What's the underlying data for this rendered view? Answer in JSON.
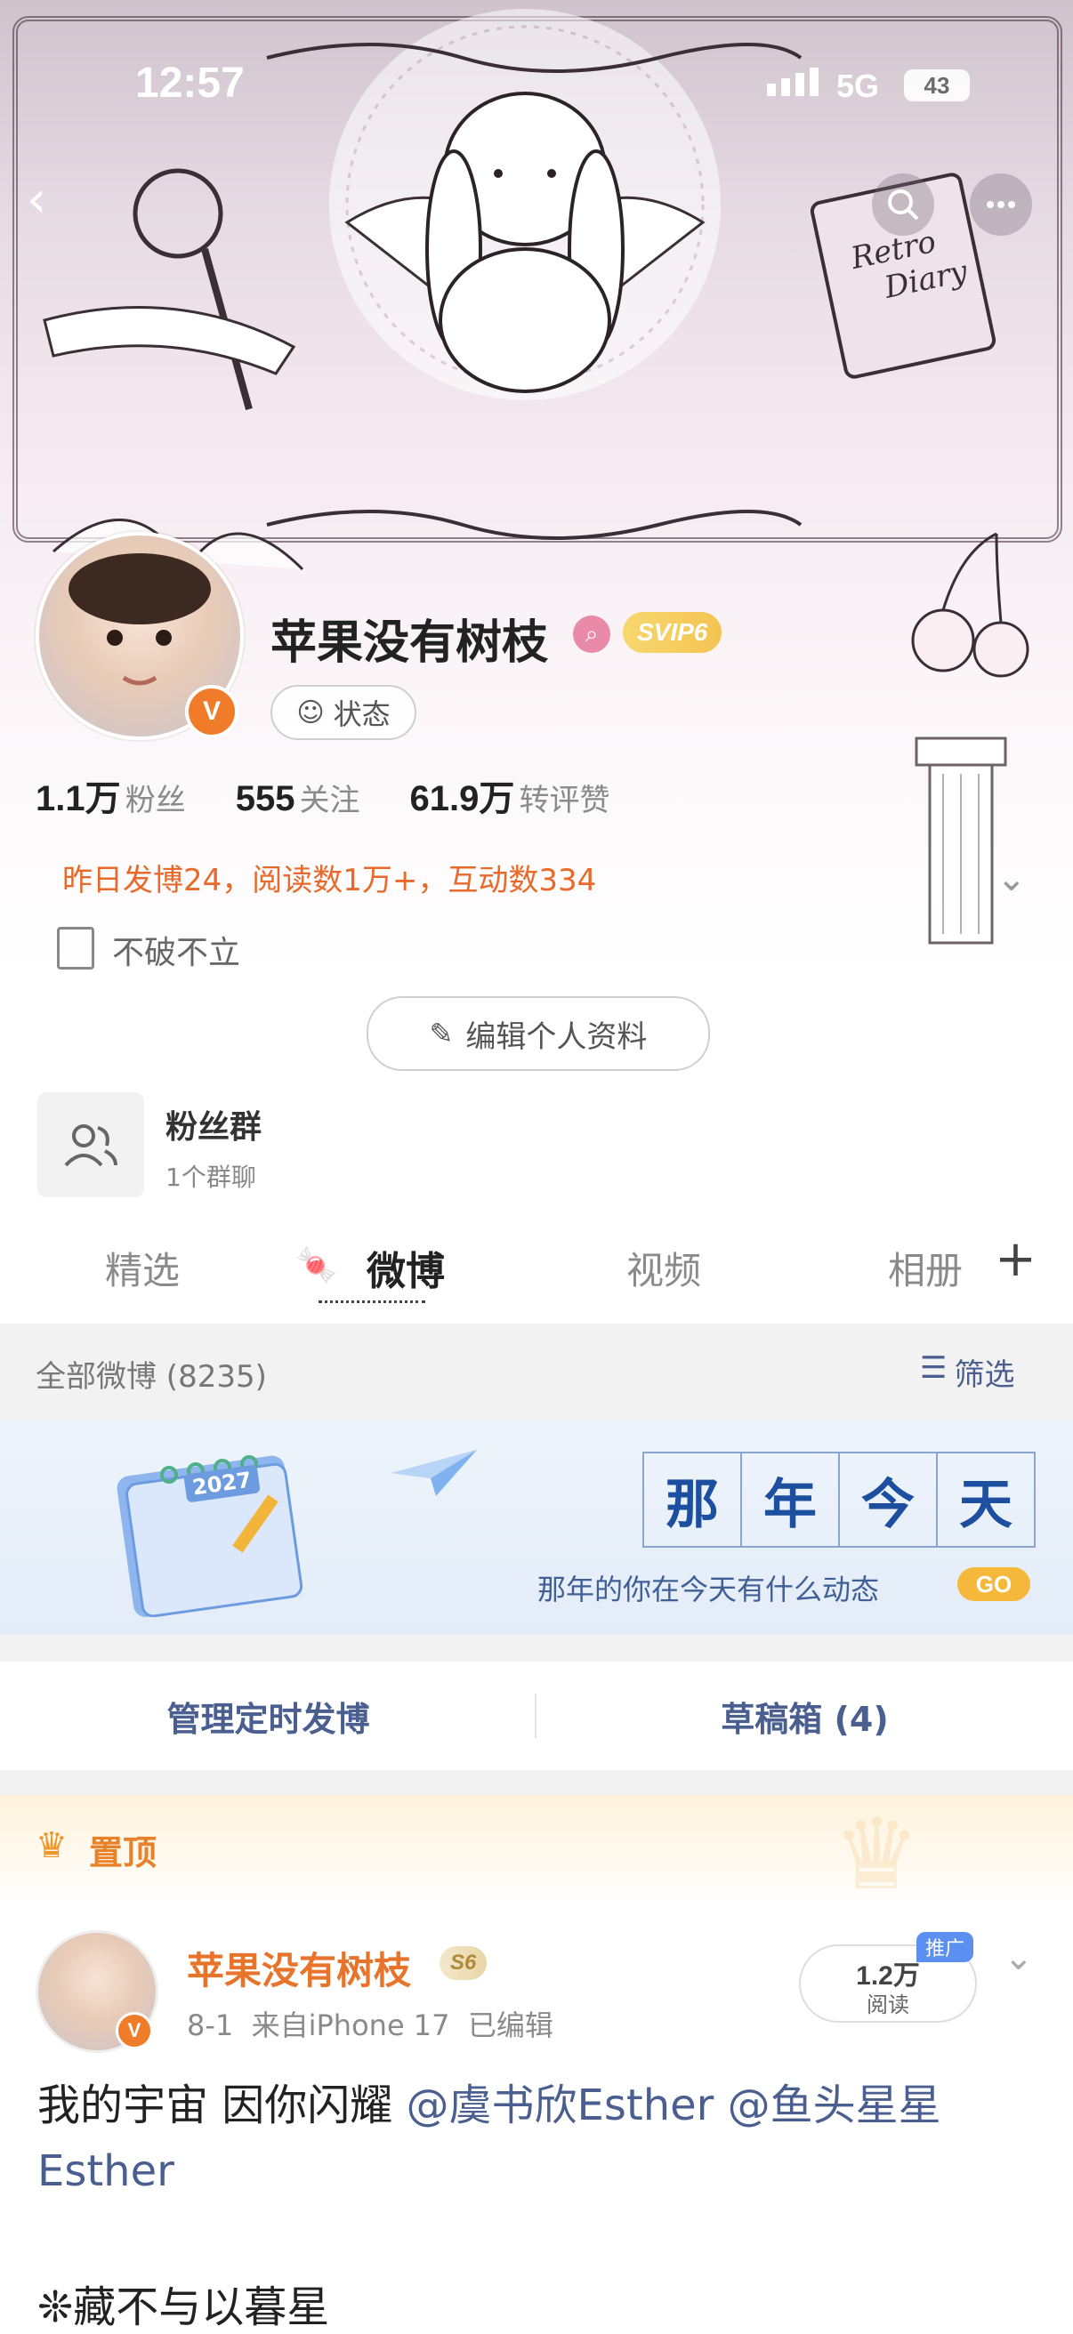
{
  "status_bar": {
    "time": "12:57",
    "network": "5G",
    "battery": "43"
  },
  "header_art": {
    "book_title_1": "Retro",
    "book_title_2": "Diary"
  },
  "profile": {
    "name": "苹果没有树枝",
    "vip_badge": "SVIP6",
    "status_label": "状态",
    "stats": [
      {
        "num": "1.1万",
        "label": "粉丝"
      },
      {
        "num": "555",
        "label": "关注"
      },
      {
        "num": "61.9万",
        "label": "转评赞"
      }
    ],
    "activity": "昨日发博24，阅读数1万+，互动数334",
    "bio": "不破不立",
    "edit_button": "编辑个人资料"
  },
  "fan_group": {
    "title": "粉丝群",
    "subtitle": "1个群聊"
  },
  "tabs": [
    "精选",
    "微博",
    "视频",
    "相册"
  ],
  "feed_header": {
    "label": "全部微博 (8235)",
    "filter": "筛选"
  },
  "banner": {
    "year": "2027",
    "title_chars": [
      "那",
      "年",
      "今",
      "天"
    ],
    "subtitle": "那年的你在今天有什么动态",
    "go": "GO"
  },
  "actions": {
    "scheduled": "管理定时发博",
    "drafts": "草稿箱 (4)"
  },
  "pinned": {
    "label": "置顶"
  },
  "post": {
    "author": "苹果没有树枝",
    "level_badge": "S6",
    "meta": "8-1  来自iPhone 17  已编辑",
    "reads_num": "1.2万",
    "reads_label": "阅读",
    "promo": "推广",
    "text_plain": "我的宇宙 因你闪耀 ",
    "mention1": "@虞书欣Esther",
    "mention2": "@鱼头星星Esther",
    "line2": "❊藏不与以暮星"
  }
}
